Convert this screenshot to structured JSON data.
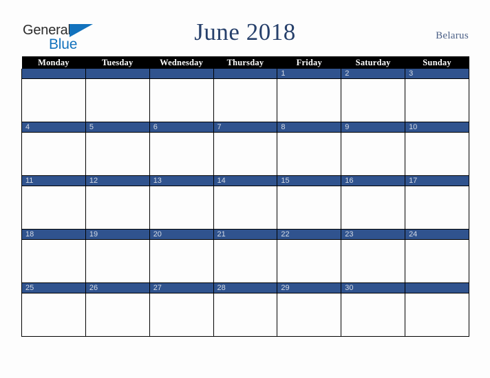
{
  "brand": {
    "name_part1": "General",
    "name_part2": "Blue",
    "triangle_icon": "triangle-icon",
    "color_dark": "#2b2b2b",
    "color_blue": "#1272bd"
  },
  "header": {
    "title": "June 2018",
    "country": "Belarus",
    "title_color": "#27406b",
    "country_color": "#4a5f86"
  },
  "calendar": {
    "accent_color": "#30538e",
    "header_bg": "#000000",
    "header_text_color": "#ffffff",
    "date_text_color": "#d5dbe6",
    "weekday_headers": [
      "Monday",
      "Tuesday",
      "Wednesday",
      "Thursday",
      "Friday",
      "Saturday",
      "Sunday"
    ],
    "weeks": [
      [
        "",
        "",
        "",
        "",
        "1",
        "2",
        "3"
      ],
      [
        "4",
        "5",
        "6",
        "7",
        "8",
        "9",
        "10"
      ],
      [
        "11",
        "12",
        "13",
        "14",
        "15",
        "16",
        "17"
      ],
      [
        "18",
        "19",
        "20",
        "21",
        "22",
        "23",
        "24"
      ],
      [
        "25",
        "26",
        "27",
        "28",
        "29",
        "30",
        ""
      ]
    ]
  }
}
